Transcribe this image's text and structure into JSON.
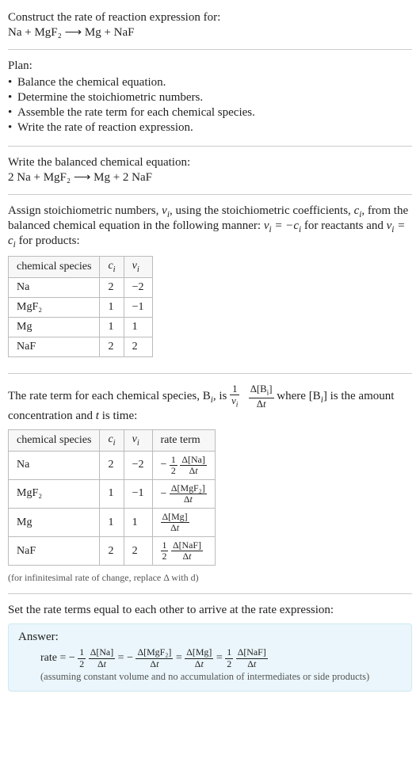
{
  "header": {
    "prompt": "Construct the rate of reaction expression for:",
    "equation_unbalanced": "Na + MgF₂  ⟶  Mg + NaF"
  },
  "plan": {
    "label": "Plan:",
    "items": [
      "Balance the chemical equation.",
      "Determine the stoichiometric numbers.",
      "Assemble the rate term for each chemical species.",
      "Write the rate of reaction expression."
    ]
  },
  "balanced": {
    "label": "Write the balanced chemical equation:",
    "equation": "2 Na + MgF₂  ⟶  Mg + 2 NaF"
  },
  "stoich": {
    "intro_a": "Assign stoichiometric numbers, ",
    "nu_i": "ν_i",
    "intro_b": ", using the stoichiometric coefficients, ",
    "c_i": "c_i",
    "intro_c": ", from the balanced chemical equation in the following manner: ",
    "rel_reactants": "ν_i = −c_i",
    "for_reactants": " for reactants and ",
    "rel_products": "ν_i = c_i",
    "for_products": " for products:",
    "headers": {
      "species": "chemical species",
      "ci": "c_i",
      "nui": "ν_i"
    },
    "rows": [
      {
        "species": "Na",
        "ci": "2",
        "nui": "−2"
      },
      {
        "species": "MgF₂",
        "ci": "1",
        "nui": "−1"
      },
      {
        "species": "Mg",
        "ci": "1",
        "nui": "1"
      },
      {
        "species": "NaF",
        "ci": "2",
        "nui": "2"
      }
    ]
  },
  "rateterm": {
    "intro_a": "The rate term for each chemical species, B",
    "intro_b": ", is ",
    "frac1_num": "1",
    "frac1_den": "ν_i",
    "frac2_num": "Δ[B_i]",
    "frac2_den": "Δt",
    "intro_c": " where [B",
    "intro_d": "] is the amount concentration and ",
    "t": "t",
    "intro_e": " is time:",
    "headers": {
      "species": "chemical species",
      "ci": "c_i",
      "nui": "ν_i",
      "rate": "rate term"
    },
    "rows": [
      {
        "species": "Na",
        "ci": "2",
        "nui": "−2",
        "coef_num": "1",
        "coef_den": "2",
        "dnum": "Δ[Na]",
        "dden": "Δt",
        "neg": true,
        "show_coef": true
      },
      {
        "species": "MgF₂",
        "ci": "1",
        "nui": "−1",
        "coef_num": "",
        "coef_den": "",
        "dnum": "Δ[MgF₂]",
        "dden": "Δt",
        "neg": true,
        "show_coef": false
      },
      {
        "species": "Mg",
        "ci": "1",
        "nui": "1",
        "coef_num": "",
        "coef_den": "",
        "dnum": "Δ[Mg]",
        "dden": "Δt",
        "neg": false,
        "show_coef": false
      },
      {
        "species": "NaF",
        "ci": "2",
        "nui": "2",
        "coef_num": "1",
        "coef_den": "2",
        "dnum": "Δ[NaF]",
        "dden": "Δt",
        "neg": false,
        "show_coef": true
      }
    ],
    "note": "(for infinitesimal rate of change, replace Δ with d)"
  },
  "final": {
    "intro": "Set the rate terms equal to each other to arrive at the rate expression:",
    "answer_label": "Answer:",
    "rate_word": "rate = ",
    "terms": [
      {
        "neg": true,
        "coef_num": "1",
        "coef_den": "2",
        "dnum": "Δ[Na]",
        "dden": "Δt",
        "show_coef": true
      },
      {
        "neg": true,
        "coef_num": "",
        "coef_den": "",
        "dnum": "Δ[MgF₂]",
        "dden": "Δt",
        "show_coef": false
      },
      {
        "neg": false,
        "coef_num": "",
        "coef_den": "",
        "dnum": "Δ[Mg]",
        "dden": "Δt",
        "show_coef": false
      },
      {
        "neg": false,
        "coef_num": "1",
        "coef_den": "2",
        "dnum": "Δ[NaF]",
        "dden": "Δt",
        "show_coef": true
      }
    ],
    "assumption": "(assuming constant volume and no accumulation of intermediates or side products)"
  }
}
